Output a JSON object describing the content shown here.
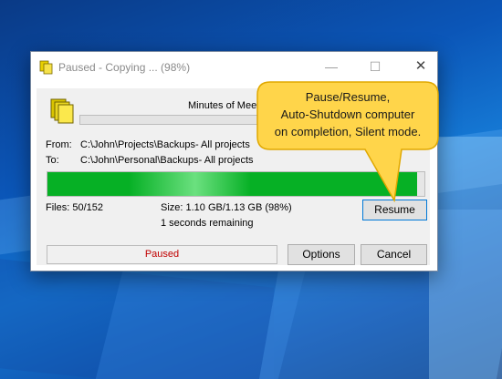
{
  "window": {
    "title": "Paused - Copying ... (98%)",
    "minimize_glyph": "—",
    "maximize_glyph": "☐",
    "close_glyph": "✕"
  },
  "transfer": {
    "current_file": "Minutes of Meeting",
    "from_label": "From:",
    "from_path": "C:\\John\\Projects\\Backups- All projects",
    "to_label": "To:",
    "to_path": "C:\\John\\Personal\\Backups- All projects",
    "progress_percent": 98,
    "file_progress_percent": 0,
    "files_text": "Files:  50/152",
    "size_text": "Size:  1.10 GB/1.13 GB (98%)",
    "remaining_text": "1 seconds remaining"
  },
  "buttons": {
    "resume": "Resume",
    "options": "Options",
    "cancel": "Cancel"
  },
  "status": {
    "text": "Paused",
    "color": "#c00000"
  },
  "callout": {
    "line1": "Pause/Resume,",
    "line2": "Auto-Shutdown computer",
    "line3": "on completion, Silent mode.",
    "fill": "#ffd54a",
    "border": "#e0a800"
  },
  "icons": {
    "app": "copy-documents-icon",
    "file": "copy-documents-icon"
  },
  "colors": {
    "progress_green": "#06b025"
  }
}
